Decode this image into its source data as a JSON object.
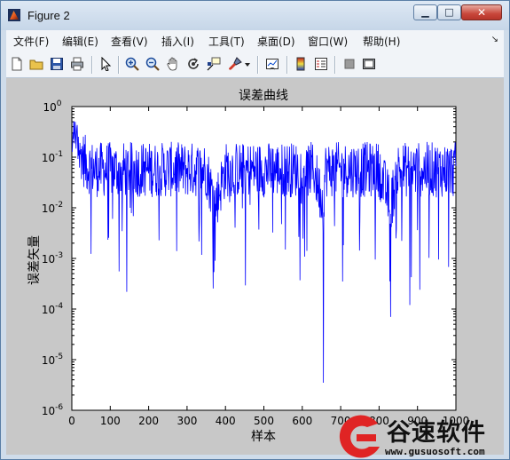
{
  "window": {
    "title": "Figure 2",
    "caption_buttons": {
      "minimize": "▁",
      "maximize": "□",
      "close": "✕"
    }
  },
  "menu": {
    "items": [
      "文件(F)",
      "编辑(E)",
      "查看(V)",
      "插入(I)",
      "工具(T)",
      "桌面(D)",
      "窗口(W)",
      "帮助(H)"
    ],
    "overflow_glyph": "↘"
  },
  "toolbar": {
    "icons": [
      "new-figure-icon",
      "open-file-icon",
      "save-icon",
      "print-icon",
      "edit-plot-arrow-icon",
      "zoom-in-icon",
      "zoom-out-icon",
      "pan-hand-icon",
      "rotate-3d-icon",
      "data-cursor-icon",
      "brush-icon",
      "brush-dropdown-icon",
      "link-plot-icon",
      "colorbar-icon",
      "legend-icon",
      "hide-plot-tools-icon",
      "show-plot-tools-icon"
    ]
  },
  "chart_data": {
    "type": "line",
    "title": "误差曲线",
    "xlabel": "样本",
    "ylabel": "误差矢量",
    "xlim": [
      0,
      1000
    ],
    "ylim": [
      1e-06,
      1
    ],
    "y_scale": "log",
    "x_ticks": [
      "0",
      "100",
      "200",
      "300",
      "400",
      "500",
      "600",
      "700",
      "800",
      "900",
      "1000"
    ],
    "y_ticks": [
      {
        "base": "10",
        "exp": "-6"
      },
      {
        "base": "10",
        "exp": "-5"
      },
      {
        "base": "10",
        "exp": "-4"
      },
      {
        "base": "10",
        "exp": "-3"
      },
      {
        "base": "10",
        "exp": "-2"
      },
      {
        "base": "10",
        "exp": "-1"
      },
      {
        "base": "10",
        "exp": "0"
      }
    ],
    "line_color": "#0000ff",
    "grid": false,
    "series_description_points": {
      "x": [
        1,
        5,
        10,
        15,
        20,
        30,
        40,
        60,
        80,
        100,
        130,
        160,
        200,
        250,
        300,
        350,
        373,
        400,
        450,
        500,
        550,
        600,
        630,
        655,
        660,
        700,
        750,
        800,
        830,
        850,
        900,
        950,
        1000
      ],
      "y": [
        0.1,
        0.45,
        0.3,
        0.2,
        0.15,
        0.08,
        0.06,
        0.05,
        0.05,
        0.05,
        0.05,
        0.05,
        0.05,
        0.05,
        0.05,
        0.05,
        0.001,
        0.05,
        0.05,
        0.05,
        0.05,
        0.05,
        0.05,
        3.5e-06,
        0.05,
        0.05,
        0.05,
        0.05,
        7e-05,
        0.05,
        0.05,
        0.05,
        0.05
      ]
    },
    "notable_minima": [
      {
        "x": 373,
        "y": 0.0009
      },
      {
        "x": 655,
        "y": 3.5e-06
      },
      {
        "x": 705,
        "y": 0.00035
      },
      {
        "x": 790,
        "y": 0.00095
      },
      {
        "x": 830,
        "y": 7e-05
      },
      {
        "x": 880,
        "y": 0.00012
      },
      {
        "x": 955,
        "y": 0.00095
      }
    ]
  },
  "watermark": {
    "brand": "谷速软件",
    "url": "www.gusuosoft.com"
  }
}
